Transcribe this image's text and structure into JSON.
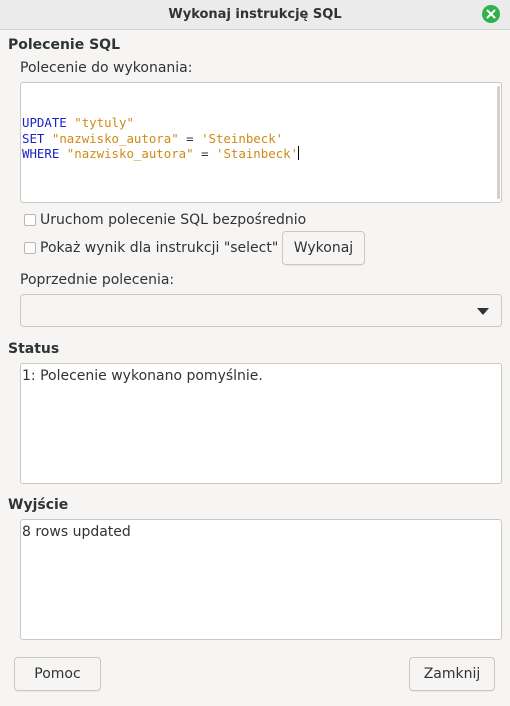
{
  "window": {
    "title": "Wykonaj instrukcję SQL",
    "close_icon": "close-icon",
    "close_color": "#2fb14d"
  },
  "sql_section": {
    "heading": "Polecenie SQL",
    "command_label": "Polecenie do wykonania:",
    "editor_lines": [
      [
        {
          "text": "UPDATE",
          "kind": "kw"
        },
        {
          "text": " ",
          "kind": "op"
        },
        {
          "text": "\"tytuly\"",
          "kind": "str"
        }
      ],
      [
        {
          "text": "SET",
          "kind": "kw"
        },
        {
          "text": " ",
          "kind": "op"
        },
        {
          "text": "\"nazwisko_autora\"",
          "kind": "str"
        },
        {
          "text": " = ",
          "kind": "op"
        },
        {
          "text": "'Steinbeck'",
          "kind": "str"
        }
      ],
      [
        {
          "text": "WHERE",
          "kind": "kw"
        },
        {
          "text": " ",
          "kind": "op"
        },
        {
          "text": "\"nazwisko_autora\"",
          "kind": "str"
        },
        {
          "text": " = ",
          "kind": "op"
        },
        {
          "text": "'Stainbeck'",
          "kind": "str"
        }
      ]
    ],
    "checkbox_direct": "Uruchom polecenie SQL bezpośrednio",
    "checkbox_show_result": "Pokaż wynik dla instrukcji \"select\"",
    "execute_button": "Wykonaj",
    "previous_label": "Poprzednie polecenia:",
    "previous_selected": ""
  },
  "status_section": {
    "heading": "Status",
    "text": "1: Polecenie wykonano pomyślnie."
  },
  "output_section": {
    "heading": "Wyjście",
    "text": "8 rows updated"
  },
  "footer": {
    "help_button": "Pomoc",
    "close_button": "Zamknij"
  },
  "colors": {
    "keyword": "#1b23c4",
    "string": "#ce8a18"
  }
}
